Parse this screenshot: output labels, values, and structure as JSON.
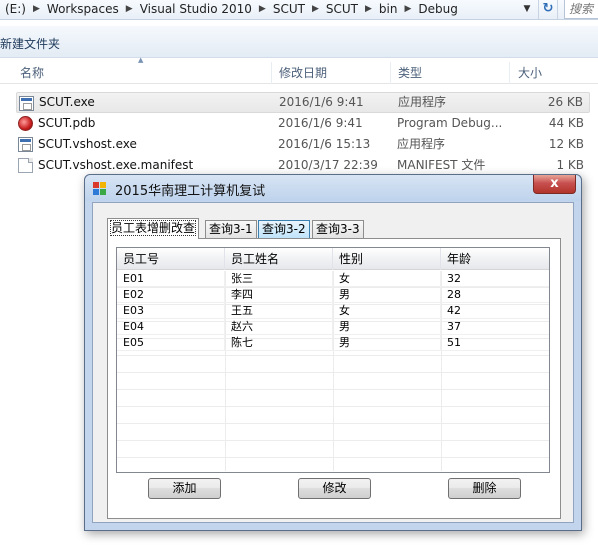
{
  "explorer": {
    "breadcrumb": [
      "(E:)",
      "Workspaces",
      "Visual Studio 2010",
      "SCUT",
      "SCUT",
      "bin",
      "Debug"
    ],
    "search_placeholder": "搜索",
    "toolbar_new_folder": "新建文件夹",
    "columns": {
      "name": "名称",
      "date": "修改日期",
      "type": "类型",
      "size": "大小"
    },
    "files": [
      {
        "name": "SCUT.exe",
        "date": "2016/1/6 9:41",
        "type": "应用程序",
        "size": "26 KB",
        "icon": "exe-icon"
      },
      {
        "name": "SCUT.pdb",
        "date": "2016/1/6 9:41",
        "type": "Program Debug...",
        "size": "44 KB",
        "icon": "pdb-icon"
      },
      {
        "name": "SCUT.vshost.exe",
        "date": "2016/1/6 15:13",
        "type": "应用程序",
        "size": "12 KB",
        "icon": "exe-icon"
      },
      {
        "name": "SCUT.vshost.exe.manifest",
        "date": "2010/3/17 22:39",
        "type": "MANIFEST 文件",
        "size": "1 KB",
        "icon": "document-icon"
      }
    ]
  },
  "window": {
    "title": "2015华南理工计算机复试",
    "close_label": "x",
    "tabs": [
      {
        "label": "员工表增删改查"
      },
      {
        "label": "查询3-1"
      },
      {
        "label": "查询3-2"
      },
      {
        "label": "查询3-3"
      }
    ],
    "grid": {
      "headers": [
        "员工号",
        "员工姓名",
        "性别",
        "年龄"
      ],
      "rows": [
        [
          "E01",
          "张三",
          "女",
          "32"
        ],
        [
          "E02",
          "李四",
          "男",
          "28"
        ],
        [
          "E03",
          "王五",
          "女",
          "42"
        ],
        [
          "E04",
          "赵六",
          "男",
          "37"
        ],
        [
          "E05",
          "陈七",
          "男",
          "51"
        ]
      ]
    },
    "buttons": {
      "add": "添加",
      "edit": "修改",
      "delete": "删除"
    }
  }
}
